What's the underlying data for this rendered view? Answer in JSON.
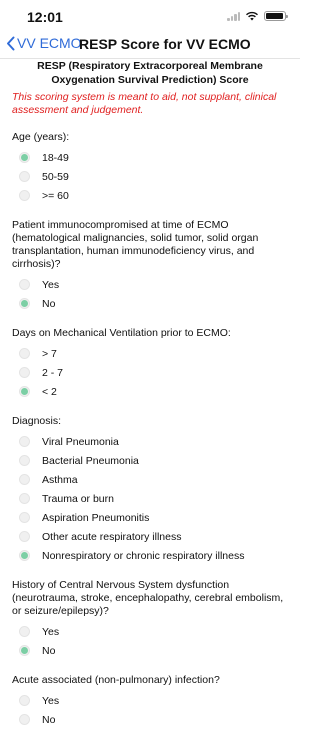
{
  "status": {
    "time": "12:01"
  },
  "nav": {
    "back_label": "VV ECMO",
    "title": "RESP Score for VV ECMO"
  },
  "sheet": {
    "title": "RESP (Respiratory Extracorporeal Membrane Oxygenation Survival Prediction) Score",
    "disclaimer": "This scoring system is meant to aid, not supplant, clinical assessment and judgement."
  },
  "questions": [
    {
      "text": "Age (years):",
      "options": [
        "18-49",
        "50-59",
        ">= 60"
      ],
      "selected": 0
    },
    {
      "text": "Patient immunocompromised at time of ECMO (hematological malignancies, solid tumor, solid organ transplantation, human immunodeficiency virus, and cirrhosis)?",
      "options": [
        "Yes",
        "No"
      ],
      "selected": 1
    },
    {
      "text": "Days on Mechanical Ventilation prior to ECMO:",
      "options": [
        "> 7",
        "2 - 7",
        "< 2"
      ],
      "selected": 2
    },
    {
      "text": "Diagnosis:",
      "options": [
        "Viral Pneumonia",
        "Bacterial Pneumonia",
        "Asthma",
        "Trauma or burn",
        "Aspiration Pneumonitis",
        "Other acute respiratory illness",
        "Nonrespiratory or chronic respiratory illness"
      ],
      "selected": 6
    },
    {
      "text": "History of Central Nervous System dysfunction (neurotrauma, stroke, encephalopathy, cerebral embolism, or seizure/epilepsy)?",
      "options": [
        "Yes",
        "No"
      ],
      "selected": 1
    },
    {
      "text": "Acute associated (non-pulmonary) infection?",
      "options": [
        "Yes",
        "No"
      ],
      "selected": -1
    }
  ],
  "colors": {
    "accent": "#2f6bd8",
    "selected_radio": "#7ccfa5",
    "disclaimer": "#e02020"
  }
}
